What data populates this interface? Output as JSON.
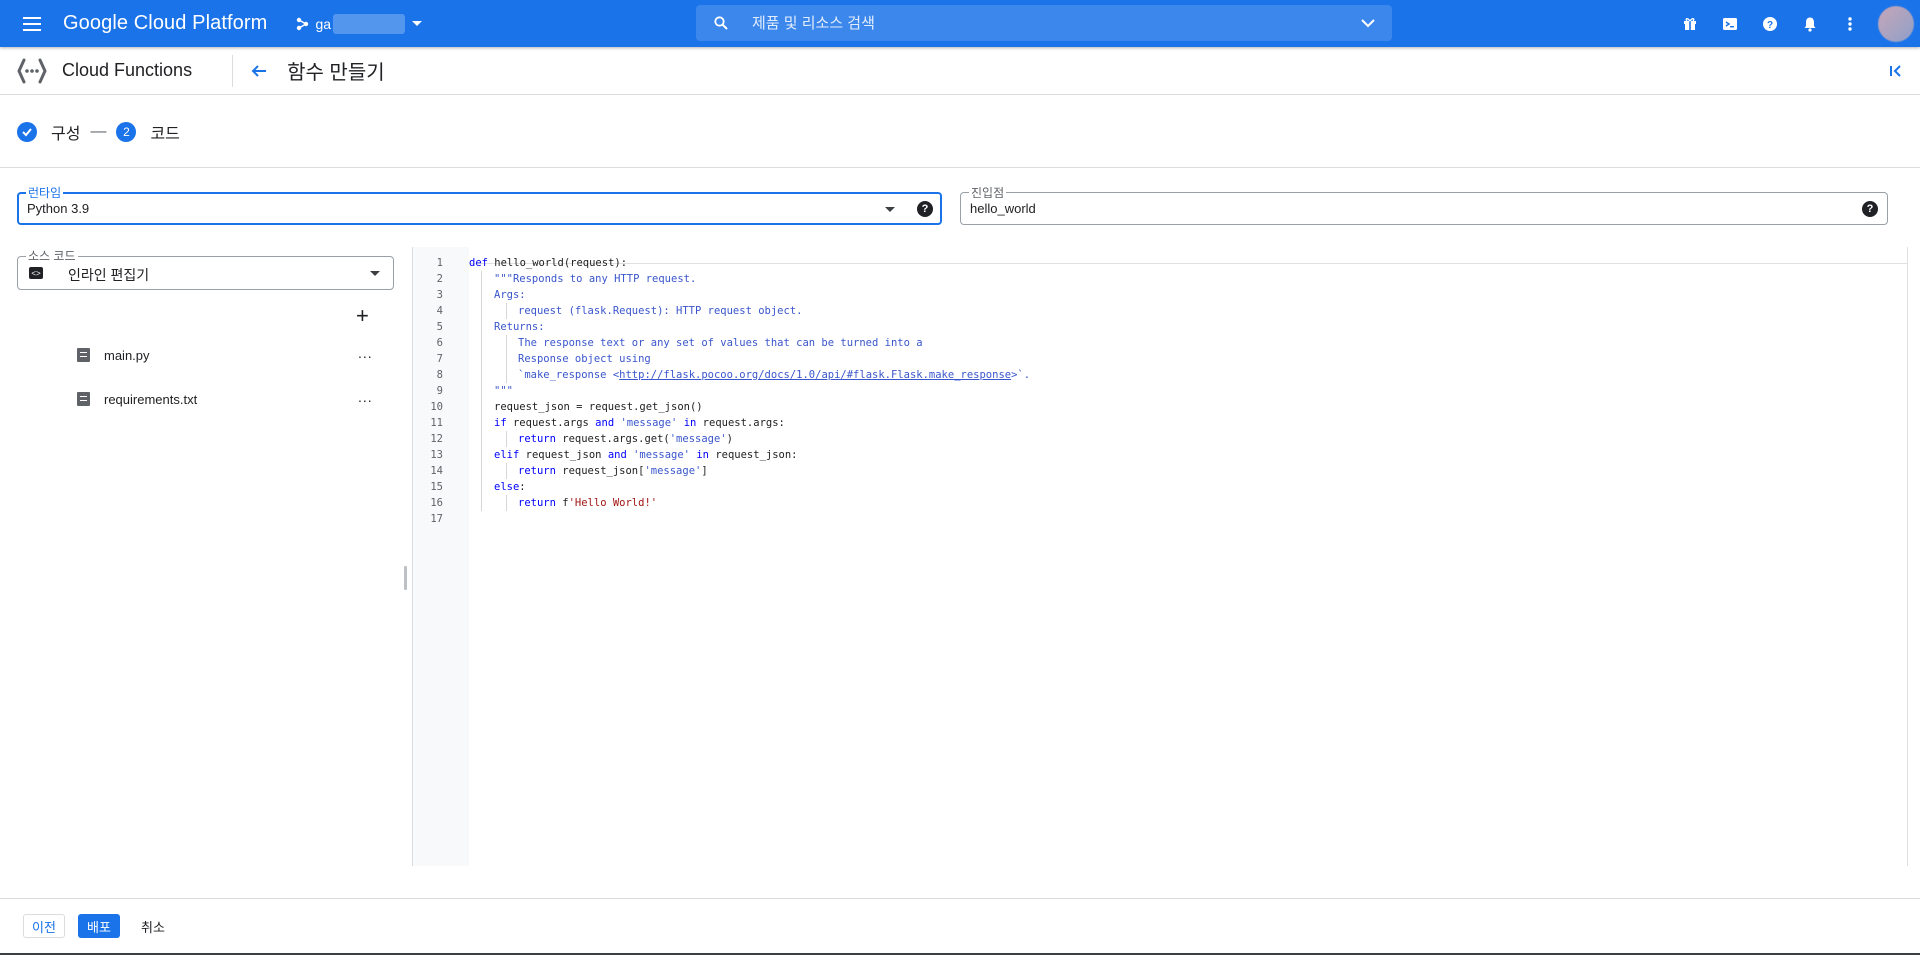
{
  "topbar": {
    "brand": "Google Cloud Platform",
    "project_name": "ga",
    "search_placeholder": "제품 및 리소스 검색"
  },
  "subheader": {
    "product": "Cloud Functions",
    "page_title": "함수 만들기"
  },
  "stepper": {
    "step1_label": "구성",
    "step2_number": "2",
    "step2_label": "코드"
  },
  "runtime": {
    "label": "런타임",
    "value": "Python 3.9"
  },
  "entry_point": {
    "label": "진입점",
    "value": "hello_world"
  },
  "source_code": {
    "label": "소스 코드",
    "value": "인라인 편집기"
  },
  "files": [
    {
      "name": "main.py"
    },
    {
      "name": "requirements.txt"
    }
  ],
  "file_more": "...",
  "code_lines": [
    {
      "n": "1"
    },
    {
      "n": "2"
    },
    {
      "n": "3"
    },
    {
      "n": "4"
    },
    {
      "n": "5"
    },
    {
      "n": "6"
    },
    {
      "n": "7"
    },
    {
      "n": "8"
    },
    {
      "n": "9"
    },
    {
      "n": "10"
    },
    {
      "n": "11"
    },
    {
      "n": "12"
    },
    {
      "n": "13"
    },
    {
      "n": "14"
    },
    {
      "n": "15"
    },
    {
      "n": "16"
    },
    {
      "n": "17"
    }
  ],
  "code": {
    "l1_kw": "def",
    "l1_rest": " hello_world(request):",
    "l2": "\"\"\"Responds to any HTTP request.",
    "l3": "Args:",
    "l4": "request (flask.Request): HTTP request object.",
    "l5": "Returns:",
    "l6": "The response text or any set of values that can be turned into a",
    "l7": "Response object using",
    "l8_pre": "`make_response <",
    "l8_link": "http://flask.pocoo.org/docs/1.0/api/#flask.Flask.make_response",
    "l8_post": ">`.",
    "l9": "\"\"\"",
    "l10": "request_json = request.get_json()",
    "l11_if": "if",
    "l11_a": " request.args ",
    "l11_and": "and",
    "l11_sp": " ",
    "l11_str": "'message'",
    "l11_sp2": " ",
    "l11_in": "in",
    "l11_b": " request.args:",
    "l12_ret": "return",
    "l12_a": " request.args.get(",
    "l12_str": "'message'",
    "l12_b": ")",
    "l13_elif": "elif",
    "l13_a": " request_json ",
    "l13_and": "and",
    "l13_sp": " ",
    "l13_str": "'message'",
    "l13_sp2": " ",
    "l13_in": "in",
    "l13_b": " request_json:",
    "l14_ret": "return",
    "l14_a": " request_json[",
    "l14_str": "'message'",
    "l14_b": "]",
    "l15_else": "else",
    "l15_colon": ":",
    "l16_ret": "return",
    "l16_a": " f",
    "l16_str": "'Hello World!'"
  },
  "footer": {
    "prev": "이전",
    "deploy": "배포",
    "cancel": "취소"
  },
  "colors": {
    "primary": "#1a73e8"
  }
}
